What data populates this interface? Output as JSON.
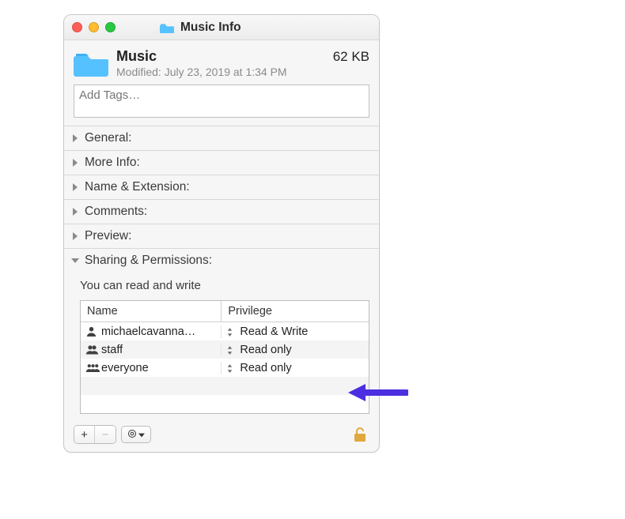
{
  "window": {
    "title": "Music Info"
  },
  "item": {
    "name": "Music",
    "size": "62 KB",
    "modified_prefix": "Modified:",
    "modified_value": "July 23, 2019 at 1:34 PM"
  },
  "tags": {
    "placeholder": "Add Tags…"
  },
  "sections": {
    "general": "General:",
    "more_info": "More Info:",
    "name_ext": "Name & Extension:",
    "comments": "Comments:",
    "preview": "Preview:",
    "sharing": "Sharing & Permissions:"
  },
  "sharing": {
    "note": "You can read and write",
    "col_name": "Name",
    "col_priv": "Privilege",
    "rows": [
      {
        "name": "michaelcavanna…",
        "priv": "Read & Write",
        "icon": "single"
      },
      {
        "name": "staff",
        "priv": "Read only",
        "icon": "double"
      },
      {
        "name": "everyone",
        "priv": "Read only",
        "icon": "triple"
      }
    ]
  },
  "footer": {
    "add": "+",
    "remove": "−"
  }
}
